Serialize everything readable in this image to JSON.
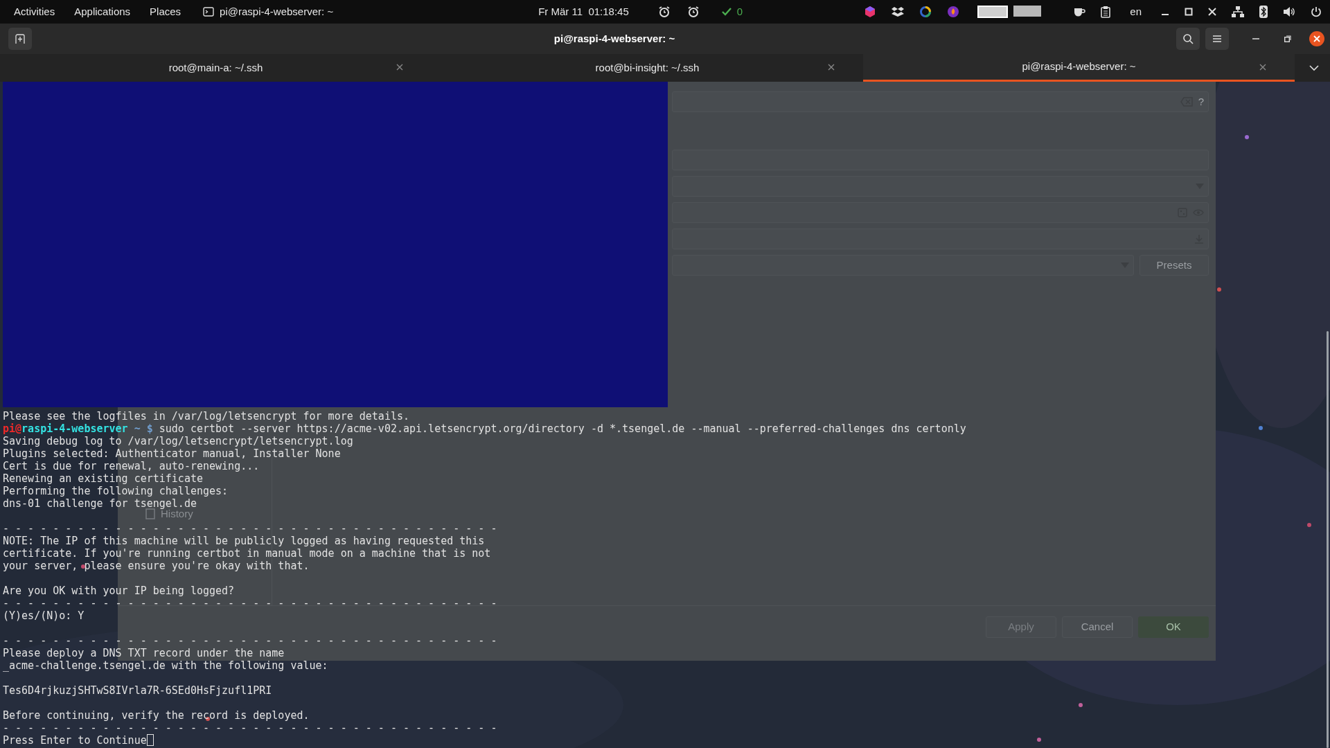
{
  "top_bar": {
    "menus": [
      {
        "label": "Activities"
      },
      {
        "label": "Applications"
      },
      {
        "label": "Places"
      }
    ],
    "app_label": "pi@raspi-4-webserver: ~",
    "clock": "Fr Mär 11  01:18:45",
    "update_count": "0",
    "language": "en"
  },
  "window": {
    "title": "pi@raspi-4-webserver: ~"
  },
  "tabs": [
    {
      "label": "root@main-a: ~/.ssh",
      "selected": false
    },
    {
      "label": "root@bi-insight: ~/.ssh",
      "selected": false
    },
    {
      "label": "pi@raspi-4-webserver: ~",
      "selected": true
    }
  ],
  "background_dialog": {
    "help": "?",
    "presets_button": "Presets",
    "sidebar_item": "History",
    "buttons": [
      {
        "label": "Apply",
        "kind": "default",
        "disabled": true
      },
      {
        "label": "Cancel",
        "kind": "default",
        "disabled": false
      },
      {
        "label": "OK",
        "kind": "primary",
        "disabled": false
      }
    ]
  },
  "terminal": {
    "lines": [
      {
        "kind": "text",
        "text": "Please see the logfiles in /var/log/letsencrypt for more details."
      },
      {
        "kind": "prompt",
        "user": "pi",
        "at": "@",
        "host": "raspi-4-webserver",
        "path": "~",
        "symbol": "$",
        "command": "sudo certbot --server https://acme-v02.api.letsencrypt.org/directory -d *.tsengel.de --manual --preferred-challenges dns certonly"
      },
      {
        "kind": "text",
        "text": "Saving debug log to /var/log/letsencrypt/letsencrypt.log"
      },
      {
        "kind": "text",
        "text": "Plugins selected: Authenticator manual, Installer None"
      },
      {
        "kind": "text",
        "text": "Cert is due for renewal, auto-renewing..."
      },
      {
        "kind": "text",
        "text": "Renewing an existing certificate"
      },
      {
        "kind": "text",
        "text": "Performing the following challenges:"
      },
      {
        "kind": "text",
        "text": "dns-01 challenge for tsengel.de"
      },
      {
        "kind": "blank"
      },
      {
        "kind": "text",
        "text": "- - - - - - - - - - - - - - - - - - - - - - - - - - - - - - - - - - - - - - - -"
      },
      {
        "kind": "text",
        "text": "NOTE: The IP of this machine will be publicly logged as having requested this"
      },
      {
        "kind": "text",
        "text": "certificate. If you're running certbot in manual mode on a machine that is not"
      },
      {
        "kind": "text",
        "text": "your server, please ensure you're okay with that."
      },
      {
        "kind": "blank"
      },
      {
        "kind": "text",
        "text": "Are you OK with your IP being logged?"
      },
      {
        "kind": "text",
        "text": "- - - - - - - - - - - - - - - - - - - - - - - - - - - - - - - - - - - - - - - -"
      },
      {
        "kind": "text",
        "text": "(Y)es/(N)o: Y"
      },
      {
        "kind": "blank"
      },
      {
        "kind": "text",
        "text": "- - - - - - - - - - - - - - - - - - - - - - - - - - - - - - - - - - - - - - - -"
      },
      {
        "kind": "text",
        "text": "Please deploy a DNS TXT record under the name"
      },
      {
        "kind": "text",
        "text": "_acme-challenge.tsengel.de with the following value:"
      },
      {
        "kind": "blank"
      },
      {
        "kind": "text",
        "text": "Tes6D4rjkuzjSHTwS8IVrla7R-6SEd0HsFjzufl1PRI"
      },
      {
        "kind": "blank"
      },
      {
        "kind": "text",
        "text": "Before continuing, verify the record is deployed."
      },
      {
        "kind": "text",
        "text": "- - - - - - - - - - - - - - - - - - - - - - - - - - - - - - - - - - - - - - - -"
      },
      {
        "kind": "input",
        "text": "Press Enter to Continue"
      }
    ]
  }
}
